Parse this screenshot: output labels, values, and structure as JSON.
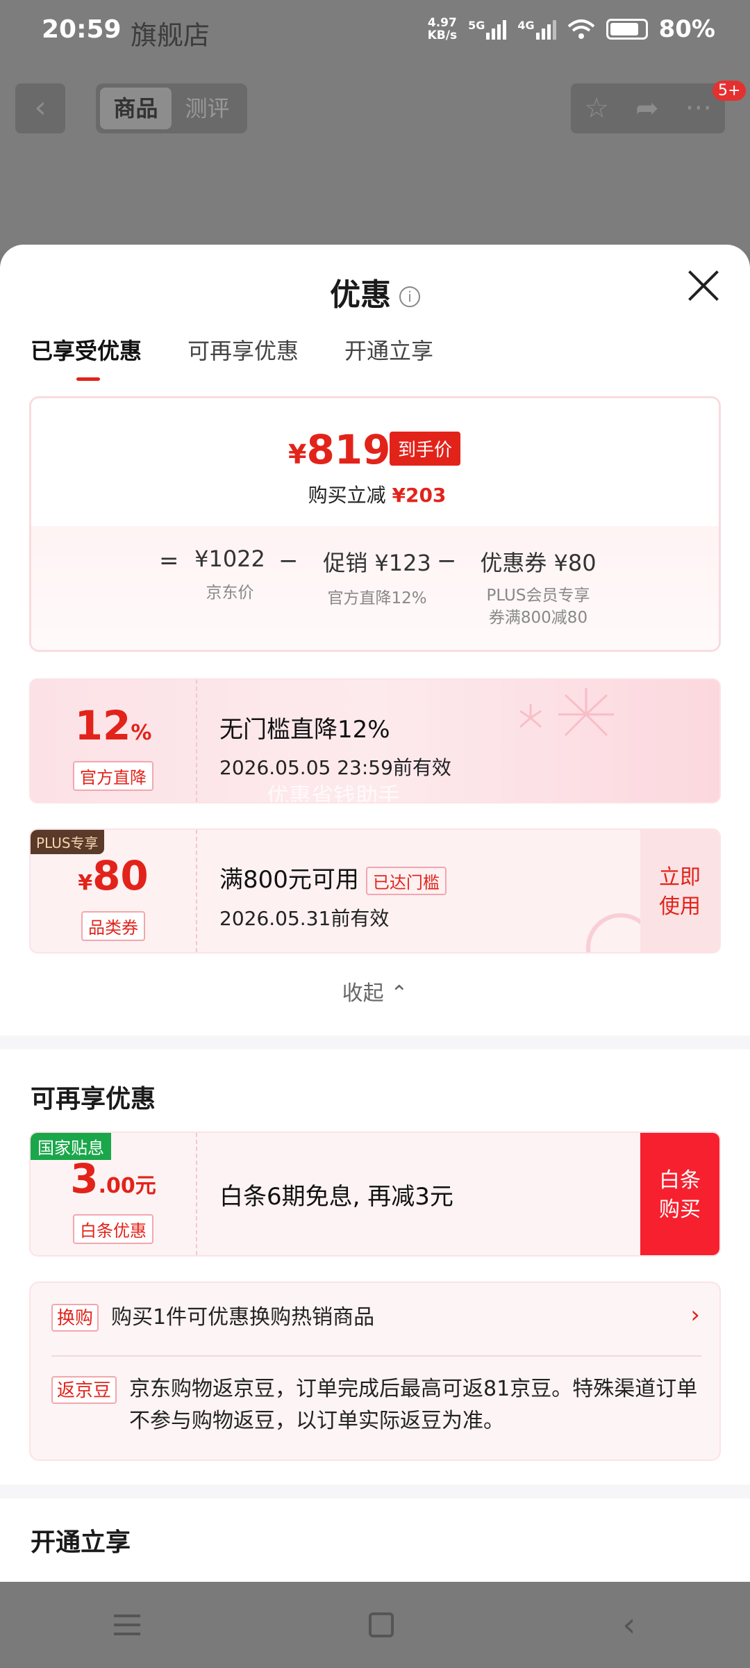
{
  "status_bar": {
    "time": "20:59",
    "store_name": "旗舰店",
    "net_speed": "4.97\nKB/s",
    "net_5g": "5G",
    "net_4g": "4G",
    "battery": "80%"
  },
  "top_nav": {
    "back": "‹",
    "tabs": [
      "商品",
      "测评"
    ],
    "badge": "5+"
  },
  "sheet": {
    "title": "优惠",
    "info_icon": "i",
    "tabs": [
      "已享受优惠",
      "可再享优惠",
      "开通立享"
    ],
    "price_card": {
      "final_price": "819",
      "currency": "¥",
      "final_label": "到手价",
      "reduce_label": "购买立减",
      "reduce_amount": "¥203",
      "equation": {
        "eq": "=",
        "base_value": "¥1022",
        "base_label": "京东价",
        "minus1": "−",
        "promo_value": "促销 ¥123",
        "promo_label": "官方直降12%",
        "minus2": "−",
        "coupon_value": "优惠券 ¥80",
        "coupon_label_1": "PLUS会员专享",
        "coupon_label_2": "券满800减80"
      }
    },
    "card_direct": {
      "value": "12",
      "unit": "%",
      "tag": "官方直降",
      "title": "无门槛直降12%",
      "expiry": "2026.05.05 23:59前有效",
      "watermark": "优惠省钱助手"
    },
    "card_plus": {
      "plus_tag": "PLUS专享",
      "currency": "¥",
      "value": "80",
      "tag": "品类券",
      "title": "满800元可用",
      "reached": "已达门槛",
      "expiry": "2026.05.31前有效",
      "action": "立即\n使用"
    },
    "collapse": "收起 ⌃",
    "more_section": {
      "title": "可再享优惠",
      "card": {
        "nat_tag": "国家贴息",
        "value_main": "3",
        "value_dec": ".00元",
        "tag": "白条优惠",
        "title": "白条6期免息, 再减3元",
        "action": "白条\n购买"
      },
      "info": [
        {
          "tag": "换购",
          "text": "购买1件可优惠换购热销商品"
        },
        {
          "tag": "返京豆",
          "text": "京东购物返京豆，订单完成后最高可返81京豆。特殊渠道订单不参与购物返豆，以订单实际返豆为准。"
        }
      ]
    },
    "open_section_title": "开通立享"
  },
  "colors": {
    "accent_red": "#e2231a",
    "green_tag": "#1aa74a",
    "plus_brown": "#5a3a29"
  }
}
